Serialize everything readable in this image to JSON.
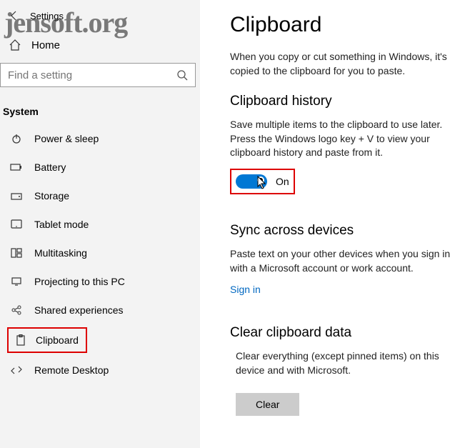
{
  "watermark": "jensoft.org",
  "header": {
    "settings": "Settings",
    "home": "Home"
  },
  "search": {
    "placeholder": "Find a setting"
  },
  "sidebar": {
    "category": "System",
    "items": [
      {
        "label": "Power & sleep"
      },
      {
        "label": "Battery"
      },
      {
        "label": "Storage"
      },
      {
        "label": "Tablet mode"
      },
      {
        "label": "Multitasking"
      },
      {
        "label": "Projecting to this PC"
      },
      {
        "label": "Shared experiences"
      },
      {
        "label": "Clipboard"
      },
      {
        "label": "Remote Desktop"
      }
    ]
  },
  "main": {
    "title": "Clipboard",
    "intro": "When you copy or cut something in Windows, it's copied to the clipboard for you to paste.",
    "history": {
      "heading": "Clipboard history",
      "desc": "Save multiple items to the clipboard to use later. Press the Windows logo key + V to view your clipboard history and paste from it.",
      "toggle_state": "On"
    },
    "sync": {
      "heading": "Sync across devices",
      "desc": "Paste text on your other devices when you sign in with a Microsoft account or work account.",
      "link": "Sign in"
    },
    "clear": {
      "heading": "Clear clipboard data",
      "desc": "Clear everything (except pinned items) on this device and with Microsoft.",
      "button": "Clear"
    }
  }
}
